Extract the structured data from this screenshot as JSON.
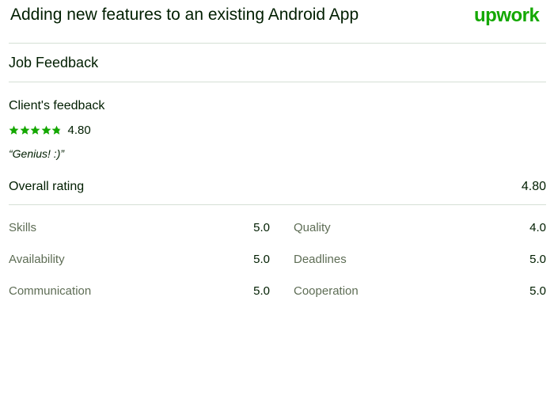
{
  "header": {
    "title": "Adding new features to an existing Android App",
    "logo_text": "upwork",
    "brand_color": "#14a800"
  },
  "feedback": {
    "section_title": "Job Feedback",
    "client_label": "Client's feedback",
    "client_rating": "4.80",
    "stars": {
      "filled": 4.8,
      "max": 5,
      "star_color": "#14a800"
    },
    "comment": "“Genius! :)”",
    "overall_label": "Overall rating",
    "overall_value": "4.80"
  },
  "metrics": [
    {
      "label": "Skills",
      "value": "5.0"
    },
    {
      "label": "Quality",
      "value": "4.0"
    },
    {
      "label": "Availability",
      "value": "5.0"
    },
    {
      "label": "Deadlines",
      "value": "5.0"
    },
    {
      "label": "Communication",
      "value": "5.0"
    },
    {
      "label": "Cooperation",
      "value": "5.0"
    }
  ]
}
